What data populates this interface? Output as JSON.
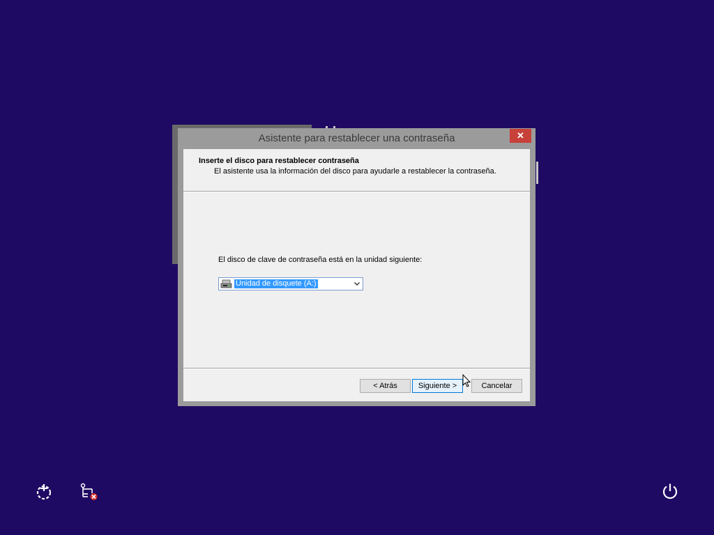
{
  "colors": {
    "desktop_background": "#1f0a63",
    "close_button": "#c7403a",
    "selection_highlight": "#3399ff"
  },
  "dialog": {
    "title": "Asistente para restablecer una contraseña",
    "close_icon": "close-icon",
    "header": {
      "title": "Inserte el disco para restablecer contraseña",
      "subtitle": "El asistente usa la información del disco para ayudarle a restablecer la contraseña."
    },
    "drive_label": "El disco de clave de contraseña está en la unidad siguiente:",
    "drive_select": {
      "icon": "floppy-drive-icon",
      "selected": "Unidad de disquete (A:)"
    },
    "buttons": {
      "back": "< Atrás",
      "next": "Siguiente >",
      "cancel": "Cancelar"
    }
  },
  "taskbar_icons": {
    "ease_of_access": "ease-of-access-icon",
    "network": "network-disconnected-icon",
    "power": "power-icon"
  }
}
